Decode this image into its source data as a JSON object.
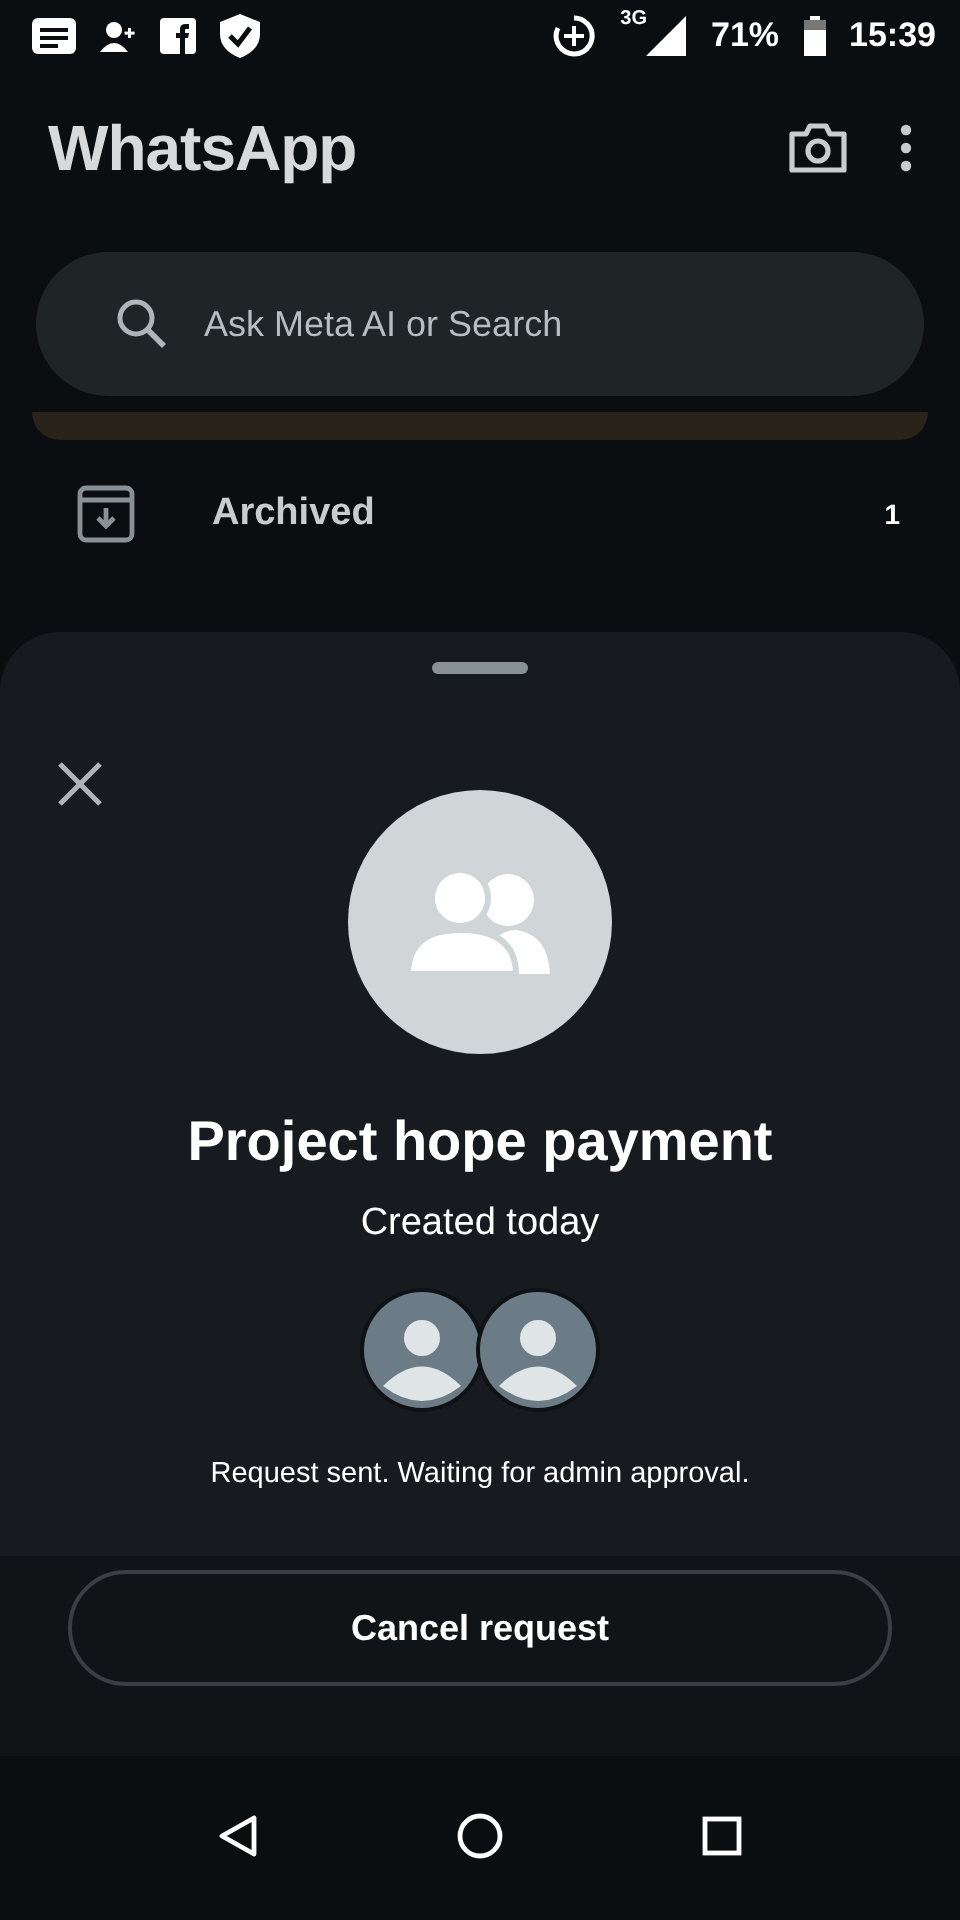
{
  "status_bar": {
    "network": "3G",
    "battery": "71%",
    "time": "15:39"
  },
  "app_bar": {
    "title": "WhatsApp"
  },
  "search": {
    "placeholder": "Ask Meta AI or Search"
  },
  "archived": {
    "label": "Archived",
    "count": "1"
  },
  "sheet": {
    "group_name": "Project hope payment",
    "subtitle": "Created today",
    "status": "Request sent. Waiting for admin approval.",
    "action": "Cancel request"
  }
}
